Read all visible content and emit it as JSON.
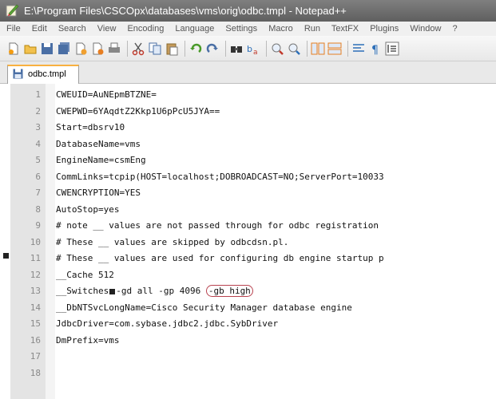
{
  "window": {
    "title": "E:\\Program Files\\CSCOpx\\databases\\vms\\orig\\odbc.tmpl - Notepad++"
  },
  "menu": [
    "File",
    "Edit",
    "Search",
    "View",
    "Encoding",
    "Language",
    "Settings",
    "Macro",
    "Run",
    "TextFX",
    "Plugins",
    "Window",
    "?"
  ],
  "tab": {
    "label": "odbc.tmpl"
  },
  "lines": [
    {
      "n": "1",
      "text": "CWEUID=AuNEpmBTZNE="
    },
    {
      "n": "2",
      "text": "CWEPWD=6YAqdtZ2Kkp1U6pPcU5JYA=="
    },
    {
      "n": "3",
      "text": "Start=dbsrv10"
    },
    {
      "n": "4",
      "text": "DatabaseName=vms"
    },
    {
      "n": "5",
      "text": "EngineName=csmEng"
    },
    {
      "n": "6",
      "text": "CommLinks=tcpip(HOST=localhost;DOBROADCAST=NO;ServerPort=10033"
    },
    {
      "n": "7",
      "text": "CWENCRYPTION=YES"
    },
    {
      "n": "8",
      "text": "AutoStop=yes"
    },
    {
      "n": "9",
      "text": "# note __ values are not passed through for odbc registration"
    },
    {
      "n": "10",
      "text": "# These __ values are skipped by odbcdsn.pl."
    },
    {
      "n": "11",
      "text": "# These __ values are used for configuring db engine startup p"
    },
    {
      "n": "12",
      "text": "__Cache 512"
    },
    {
      "n": "13",
      "pre": "__Switches",
      "post": "-gd all -gp 4096 ",
      "hl": "-gb high"
    },
    {
      "n": "14",
      "text": "__DbNTSvcLongName=Cisco Security Manager database engine"
    },
    {
      "n": "15",
      "text": "JdbcDriver=com.sybase.jdbc2.jdbc.SybDriver"
    },
    {
      "n": "16",
      "text": "DmPrefix=vms"
    },
    {
      "n": "17",
      "text": ""
    },
    {
      "n": "18",
      "text": ""
    }
  ],
  "colors": {
    "highlight_oval": "#b8424f",
    "tab_accent": "#f8b040"
  }
}
